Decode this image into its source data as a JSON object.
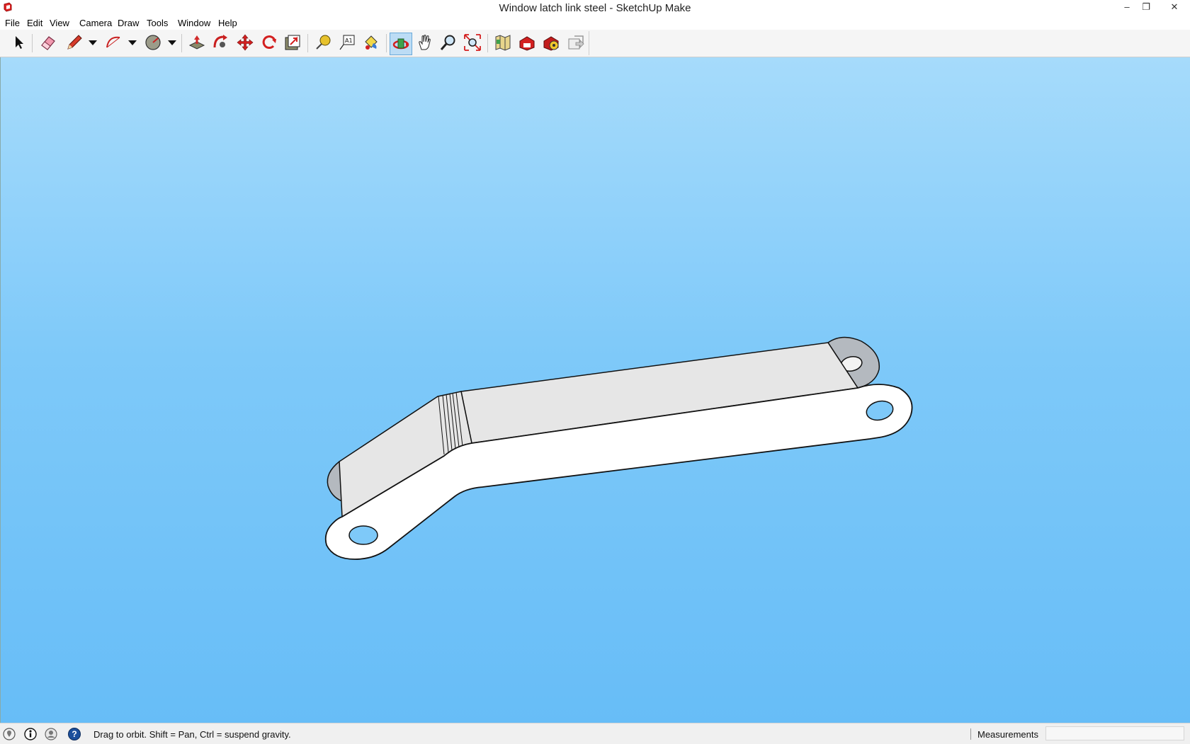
{
  "window": {
    "title": "Window latch link steel - SketchUp Make",
    "minimize_glyph": "–",
    "restore_glyph": "❐",
    "close_glyph": "✕"
  },
  "menu": [
    {
      "label": "File"
    },
    {
      "label": "Edit"
    },
    {
      "label": "View"
    },
    {
      "label": "Camera"
    },
    {
      "label": "Draw"
    },
    {
      "label": "Tools"
    },
    {
      "label": "Window"
    },
    {
      "label": "Help"
    }
  ],
  "toolbar": {
    "tools": [
      {
        "name": "select",
        "icon": "arrow-cursor-icon"
      },
      {
        "name": "eraser",
        "icon": "eraser-icon"
      },
      {
        "name": "line",
        "icon": "pencil-icon"
      },
      {
        "name": "arc",
        "icon": "arc-icon"
      },
      {
        "name": "shapes",
        "icon": "circle-shape-icon"
      },
      {
        "name": "push-pull",
        "icon": "push-pull-icon"
      },
      {
        "name": "follow-me",
        "icon": "follow-me-icon"
      },
      {
        "name": "move",
        "icon": "move-icon"
      },
      {
        "name": "rotate",
        "icon": "rotate-icon"
      },
      {
        "name": "scale",
        "icon": "scale-icon"
      },
      {
        "name": "tape-measure",
        "icon": "tape-measure-icon"
      },
      {
        "name": "text",
        "icon": "text-icon"
      },
      {
        "name": "paint-bucket",
        "icon": "paint-bucket-icon"
      },
      {
        "name": "orbit",
        "icon": "orbit-icon",
        "active": true
      },
      {
        "name": "pan",
        "icon": "pan-hand-icon"
      },
      {
        "name": "zoom",
        "icon": "zoom-icon"
      },
      {
        "name": "zoom-extents",
        "icon": "zoom-extents-icon"
      },
      {
        "name": "add-location",
        "icon": "add-location-icon"
      },
      {
        "name": "3d-warehouse",
        "icon": "warehouse-icon"
      },
      {
        "name": "extension-warehouse",
        "icon": "extension-warehouse-icon"
      },
      {
        "name": "send-to-layout",
        "icon": "send-to-layout-icon"
      }
    ],
    "text_tool_glyph": "A1",
    "accent": "#bcdcf5"
  },
  "viewport": {
    "sky_top": "#a6dbfb",
    "sky_bottom": "#67bdf7",
    "model_face": "#ffffff",
    "model_side": "#e6e6e6",
    "model_back": "#b4b9bf"
  },
  "statusbar": {
    "hint": "Drag to orbit. Shift = Pan, Ctrl = suspend gravity.",
    "measurements_label": "Measurements",
    "measurements_value": "",
    "icons": [
      "geolocation-icon",
      "credits-icon",
      "user-icon",
      "help-icon"
    ],
    "help_glyph": "?"
  }
}
